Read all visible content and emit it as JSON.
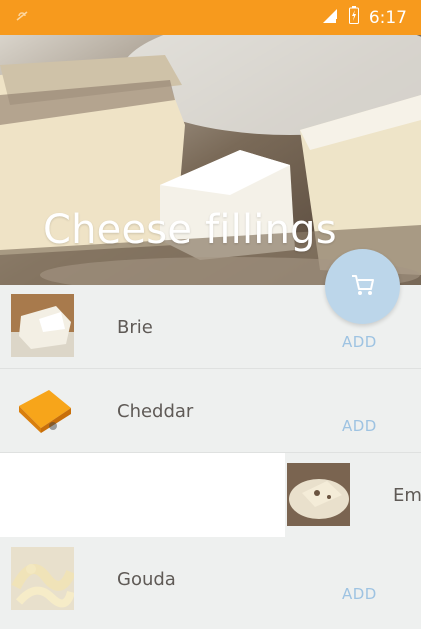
{
  "status_bar": {
    "time": "6:17",
    "left_icon": "android-debug-icon",
    "right_icons": [
      "signal-icon",
      "battery-charging-icon"
    ],
    "color": "#f79a1d"
  },
  "header": {
    "title": "Cheese fillings"
  },
  "fab": {
    "icon": "cart-icon",
    "color": "#bcd6ea"
  },
  "items": [
    {
      "name": "Brie",
      "action": "ADD"
    },
    {
      "name": "Cheddar",
      "action": "ADD"
    },
    {
      "name": "Emmental",
      "action": ""
    },
    {
      "name": "Gouda",
      "action": "ADD"
    }
  ],
  "colors": {
    "accent": "#9ec3e2",
    "list_background": "#eef0ef",
    "text": "#5f5a56"
  }
}
